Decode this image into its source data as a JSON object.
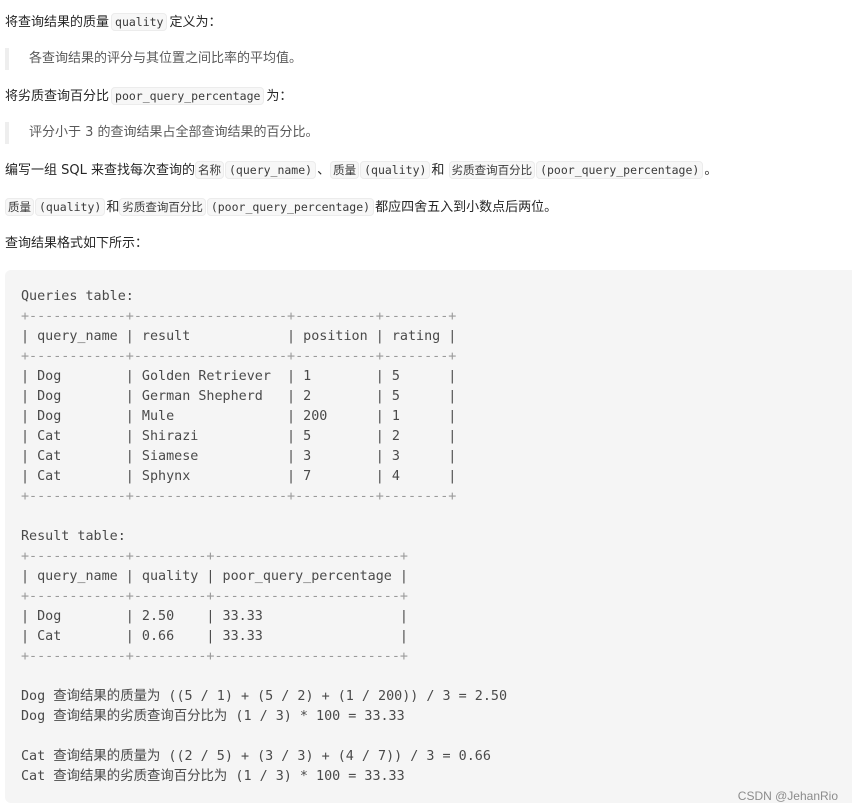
{
  "intro": {
    "quality_def_prefix": "将查询结果的质量",
    "quality_code": "quality",
    "quality_def_suffix": "定义为：",
    "quality_quote": "各查询结果的评分与其位置之间比率的平均值。",
    "poor_def_prefix": "将劣质查询百分比",
    "poor_code": "poor_query_percentage",
    "poor_def_suffix": "为：",
    "poor_quote": "评分小于 3 的查询结果占全部查询结果的百分比。"
  },
  "task": {
    "line1_prefix": "编写一组 SQL 来查找每次查询的",
    "name_cn": "名称",
    "name_code": "(query_name)",
    "sep1": "、",
    "quality_cn": "质量",
    "quality_code": "(quality)",
    "and": "和",
    "poor_cn": "劣质查询百分比",
    "poor_code": "(poor_query_percentage)",
    "end": "。",
    "line2_quality_cn": "质量",
    "line2_quality_code": "(quality)",
    "line2_and": "和",
    "line2_poor_cn": "劣质查询百分比",
    "line2_poor_code": "(poor_query_percentage)",
    "line2_suffix": "都应四舍五入到小数点后两位。",
    "format_intro": "查询结果格式如下所示："
  },
  "example": {
    "queries_title": "Queries table:",
    "queries_columns": [
      "query_name",
      "result",
      "position",
      "rating"
    ],
    "queries_rows": [
      [
        "Dog",
        "Golden Retriever",
        "1",
        "5"
      ],
      [
        "Dog",
        "German Shepherd",
        "2",
        "5"
      ],
      [
        "Dog",
        "Mule",
        "200",
        "1"
      ],
      [
        "Cat",
        "Shirazi",
        "5",
        "2"
      ],
      [
        "Cat",
        "Siamese",
        "3",
        "3"
      ],
      [
        "Cat",
        "Sphynx",
        "7",
        "4"
      ]
    ],
    "result_title": "Result table:",
    "result_columns": [
      "query_name",
      "quality",
      "poor_query_percentage"
    ],
    "result_rows": [
      [
        "Dog",
        "2.50",
        "33.33"
      ],
      [
        "Cat",
        "0.66",
        "33.33"
      ]
    ],
    "explanations": [
      "Dog 查询结果的质量为 ((5 / 1) + (5 / 2) + (1 / 200)) / 3 = 2.50",
      "Dog 查询结果的劣质查询百分比为 (1 / 3) * 100 = 33.33",
      "",
      "Cat 查询结果的质量为 ((2 / 5) + (3 / 3) + (4 / 7)) / 3 = 0.66",
      "Cat 查询结果的劣质查询百分比为 (1 / 3) * 100 = 33.33"
    ]
  },
  "watermark": "CSDN @JehanRio"
}
